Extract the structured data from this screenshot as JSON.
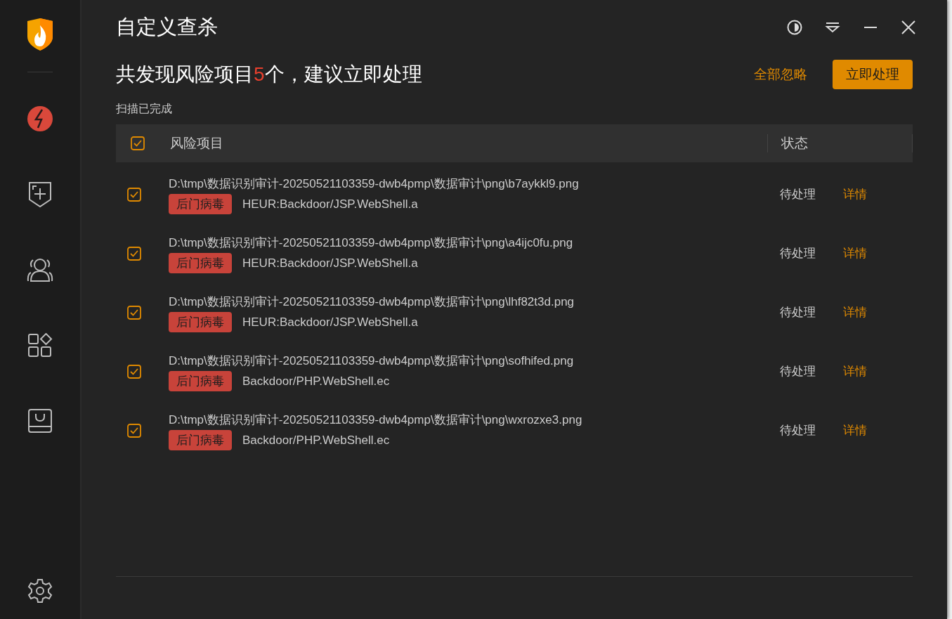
{
  "window": {
    "title": "自定义查杀"
  },
  "summary": {
    "prefix": "共发现风险项目",
    "count": "5",
    "suffix": "个，建议立即处理",
    "status": "扫描已完成"
  },
  "actions": {
    "ignore_all": "全部忽略",
    "handle_now": "立即处理"
  },
  "table": {
    "select_all": {
      "checked": true
    },
    "columns": [
      "风险项目",
      "状态"
    ],
    "rows": [
      {
        "checked": true,
        "path": "D:\\tmp\\数据识别审计-20250521103359-dwb4pmp\\数据审计\\png\\b7aykkl9.png",
        "tag": "后门病毒",
        "threat": "HEUR:Backdoor/JSP.WebShell.a",
        "status": "待处理",
        "action": "详情"
      },
      {
        "checked": true,
        "path": "D:\\tmp\\数据识别审计-20250521103359-dwb4pmp\\数据审计\\png\\a4ijc0fu.png",
        "tag": "后门病毒",
        "threat": "HEUR:Backdoor/JSP.WebShell.a",
        "status": "待处理",
        "action": "详情"
      },
      {
        "checked": true,
        "path": "D:\\tmp\\数据识别审计-20250521103359-dwb4pmp\\数据审计\\png\\lhf82t3d.png",
        "tag": "后门病毒",
        "threat": "HEUR:Backdoor/JSP.WebShell.a",
        "status": "待处理",
        "action": "详情"
      },
      {
        "checked": true,
        "path": "D:\\tmp\\数据识别审计-20250521103359-dwb4pmp\\数据审计\\png\\sofhifed.png",
        "tag": "后门病毒",
        "threat": "Backdoor/PHP.WebShell.ec",
        "status": "待处理",
        "action": "详情"
      },
      {
        "checked": true,
        "path": "D:\\tmp\\数据识别审计-20250521103359-dwb4pmp\\数据审计\\png\\wxrozxe3.png",
        "tag": "后门病毒",
        "threat": "Backdoor/PHP.WebShell.ec",
        "status": "待处理",
        "action": "详情"
      }
    ]
  }
}
